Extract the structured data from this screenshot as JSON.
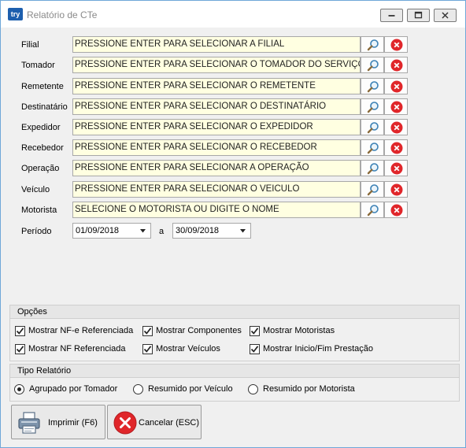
{
  "window": {
    "app_icon_text": "try",
    "title": "Relatório de CTe"
  },
  "fields": [
    {
      "label": "Filial",
      "value": "PRESSIONE ENTER PARA SELECIONAR A FILIAL"
    },
    {
      "label": "Tomador",
      "value": "PRESSIONE ENTER PARA SELECIONAR O TOMADOR DO SERVIÇO"
    },
    {
      "label": "Remetente",
      "value": "PRESSIONE ENTER PARA SELECIONAR O REMETENTE"
    },
    {
      "label": "Destinatário",
      "value": "PRESSIONE ENTER PARA SELECIONAR O DESTINATÁRIO"
    },
    {
      "label": "Expedidor",
      "value": "PRESSIONE ENTER PARA SELECIONAR O EXPEDIDOR"
    },
    {
      "label": "Recebedor",
      "value": "PRESSIONE ENTER PARA SELECIONAR O RECEBEDOR"
    },
    {
      "label": "Operação",
      "value": "PRESSIONE ENTER PARA SELECIONAR A OPERAÇÃO"
    },
    {
      "label": "Veículo",
      "value": "PRESSIONE ENTER PARA SELECIONAR O VEICULO"
    },
    {
      "label": "Motorista",
      "value": "SELECIONE O MOTORISTA OU DIGITE O NOME"
    }
  ],
  "period": {
    "label": "Período",
    "start": "01/09/2018",
    "separator": "a",
    "end": "30/09/2018"
  },
  "options": {
    "title": "Opções",
    "items": [
      {
        "label": "Mostrar NF-e Referenciada",
        "checked": true
      },
      {
        "label": "Mostrar Componentes",
        "checked": true
      },
      {
        "label": "Mostrar Motoristas",
        "checked": true
      },
      {
        "label": "Mostrar NF Referenciada",
        "checked": true
      },
      {
        "label": "Mostrar Veículos",
        "checked": true
      },
      {
        "label": "Mostrar Inicio/Fim Prestação",
        "checked": true
      }
    ]
  },
  "report_type": {
    "title": "Tipo Relatório",
    "items": [
      {
        "label": "Agrupado por Tomador",
        "selected": true
      },
      {
        "label": "Resumido por Veículo",
        "selected": false
      },
      {
        "label": "Resumido por Motorista",
        "selected": false
      }
    ]
  },
  "actions": {
    "print_label": "Imprimir (F6)",
    "cancel_label": "Cancelar (ESC)"
  },
  "icons": {
    "search": "magnifier-icon",
    "clear": "clear-icon",
    "print": "printer-icon",
    "cancel": "cancel-icon"
  },
  "colors": {
    "input_background": "#ffffe1",
    "clear_red": "#e0262a",
    "window_border": "#6fa7d8"
  }
}
